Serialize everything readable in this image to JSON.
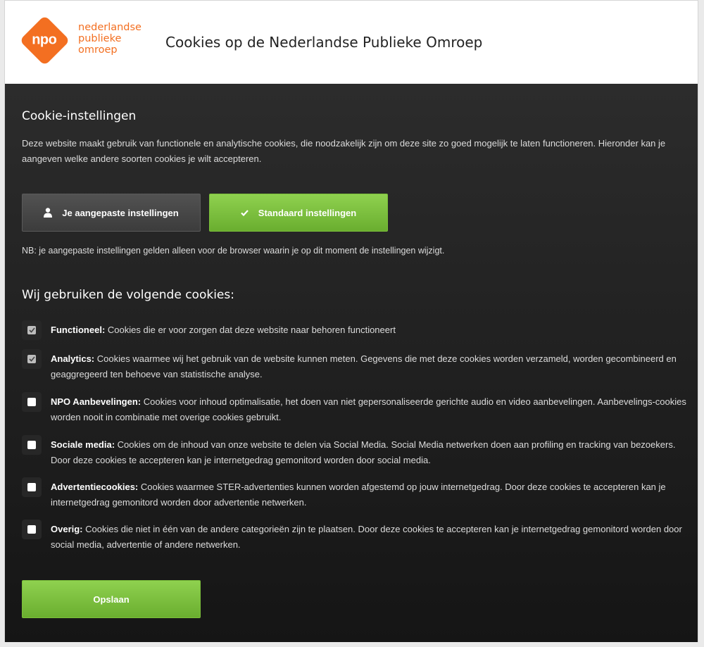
{
  "header": {
    "logo_tile": "npo",
    "logo_lines": [
      "nederlandse",
      "publieke",
      "omroep"
    ],
    "title": "Cookies op de Nederlandse Publieke Omroep"
  },
  "settings": {
    "title": "Cookie-instellingen",
    "intro": "Deze website maakt gebruik van functionele en analytische cookies, die noodzakelijk zijn om deze site zo goed mogelijk te laten functioneren. Hieronder kan je aangeven welke andere soorten cookies je wilt accepteren.",
    "custom_button": {
      "label": "Je aangepaste instellingen",
      "icon": "user-icon"
    },
    "standard_button": {
      "label": "Standaard instellingen",
      "icon": "check-icon"
    },
    "note": "NB: je aangepaste instellingen gelden alleen voor de browser waarin je op dit moment de instellingen wijzigt."
  },
  "cookies": {
    "title": "Wij gebruiken de volgende cookies:",
    "items": [
      {
        "name": "Functioneel:",
        "desc": "Cookies die er voor zorgen dat deze website naar behoren functioneert",
        "checked": true,
        "disabled": true
      },
      {
        "name": "Analytics:",
        "desc": "Cookies waarmee wij het gebruik van de website kunnen meten. Gegevens die met deze cookies worden verzameld, worden gecombineerd en geaggregeerd ten behoeve van statistische analyse.",
        "checked": true,
        "disabled": true
      },
      {
        "name": "NPO Aanbevelingen:",
        "desc": "Cookies voor inhoud optimalisatie, het doen van niet gepersonaliseerde gerichte audio en video aanbevelingen. Aanbevelings-cookies worden nooit in combinatie met overige cookies gebruikt.",
        "checked": false,
        "disabled": false
      },
      {
        "name": "Sociale media:",
        "desc": "Cookies om de inhoud van onze website te delen via Social Media. Social Media netwerken doen aan profiling en tracking van bezoekers. Door deze cookies te accepteren kan je internetgedrag gemonitord worden door social media.",
        "checked": false,
        "disabled": false
      },
      {
        "name": "Advertentiecookies:",
        "desc": "Cookies waarmee STER-advertenties kunnen worden afgestemd op jouw internetgedrag. Door deze cookies te accepteren kan je internetgedrag gemonitord worden door advertentie netwerken.",
        "checked": false,
        "disabled": false
      },
      {
        "name": "Overig:",
        "desc": "Cookies die niet in één van de andere categorieën zijn te plaatsen. Door deze cookies te accepteren kan je internetgedrag gemonitord worden door social media, advertentie of andere netwerken.",
        "checked": false,
        "disabled": false
      }
    ],
    "save_label": "Opslaan"
  },
  "colors": {
    "brand_orange": "#f36f21",
    "accent_green": "#7bbf3a",
    "panel_dark": "#1f1f1f"
  }
}
